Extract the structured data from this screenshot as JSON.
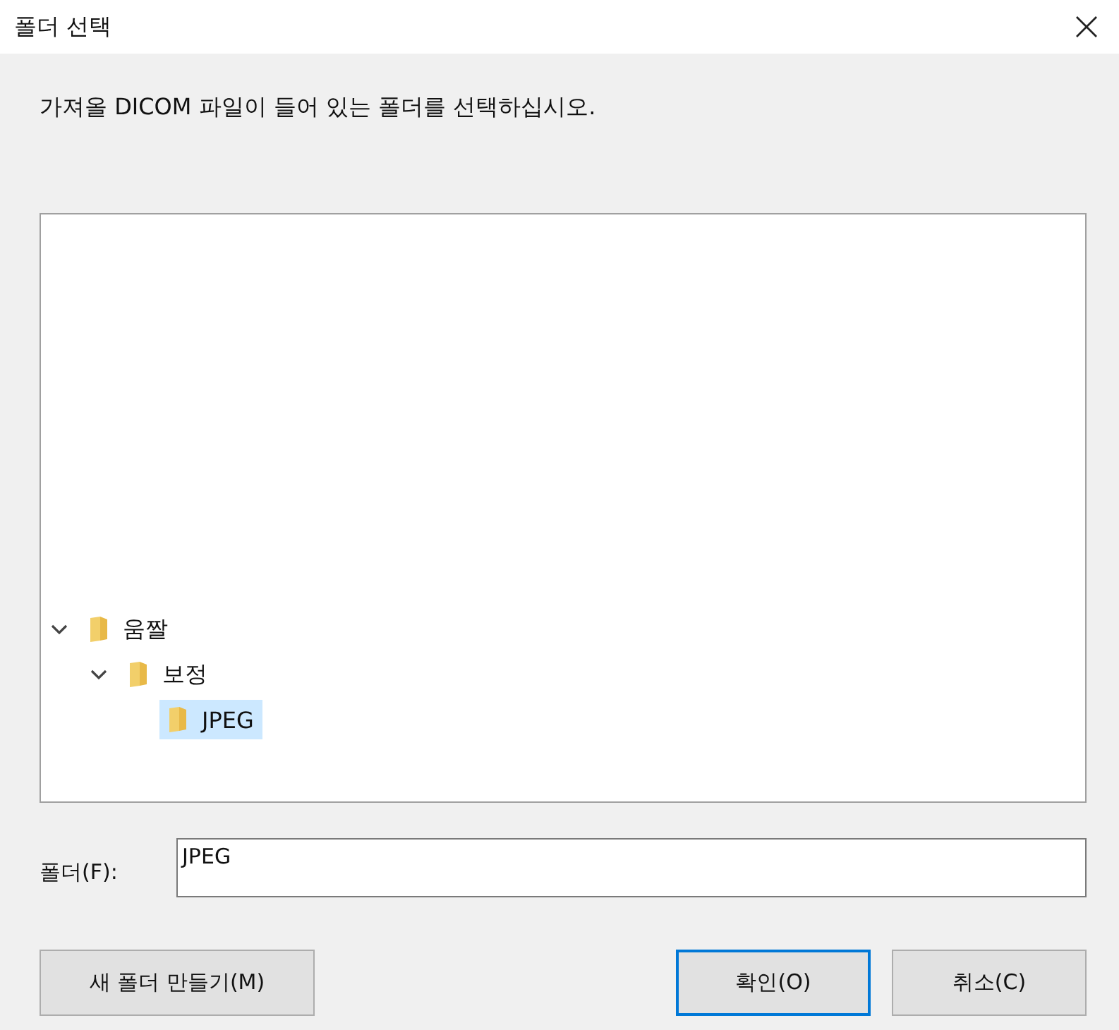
{
  "window": {
    "title": "폴더 선택"
  },
  "instruction": "가져올 DICOM 파일이 들어 있는 폴더를 선택하십시오.",
  "tree": [
    {
      "label": "움짤",
      "expanded": true,
      "selected": false,
      "children": [
        {
          "label": "보정",
          "expanded": true,
          "selected": false,
          "children": [
            {
              "label": "JPEG",
              "selected": true
            }
          ]
        }
      ]
    }
  ],
  "folder_field": {
    "label": "폴더(F):",
    "value": "JPEG"
  },
  "buttons": [
    {
      "label": "새 폴더 만들기(M)",
      "kind": "secondary"
    },
    {
      "label": "확인(O)",
      "kind": "default"
    },
    {
      "label": "취소(C)",
      "kind": "secondary"
    }
  ]
}
